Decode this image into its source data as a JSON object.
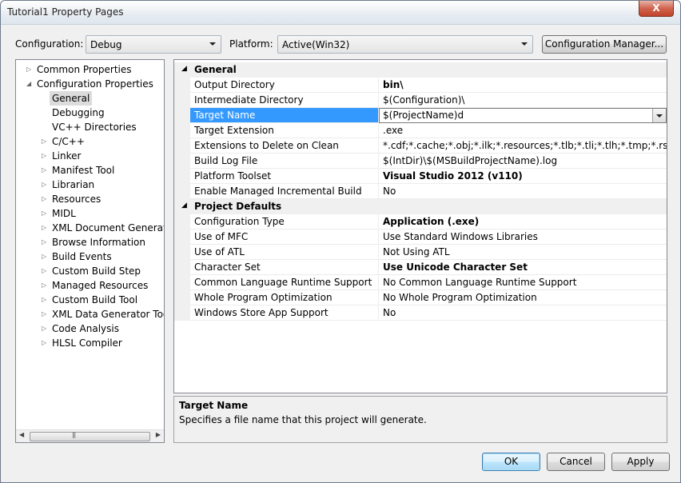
{
  "window": {
    "title": "Tutorial1 Property Pages",
    "close_glyph": "X"
  },
  "toolbar": {
    "configuration_label": "Configuration:",
    "configuration_value": "Debug",
    "platform_label": "Platform:",
    "platform_value": "Active(Win32)",
    "config_manager_label": "Configuration Manager..."
  },
  "tree": {
    "items": [
      {
        "label": "Common Properties",
        "expander": "right"
      },
      {
        "label": "Configuration Properties",
        "expander": "down"
      },
      {
        "label": "General",
        "selected": true
      },
      {
        "label": "Debugging"
      },
      {
        "label": "VC++ Directories"
      },
      {
        "label": "C/C++",
        "expander": "right"
      },
      {
        "label": "Linker",
        "expander": "right"
      },
      {
        "label": "Manifest Tool",
        "expander": "right"
      },
      {
        "label": "Librarian",
        "expander": "right"
      },
      {
        "label": "Resources",
        "expander": "right"
      },
      {
        "label": "MIDL",
        "expander": "right"
      },
      {
        "label": "XML Document Generator",
        "expander": "right"
      },
      {
        "label": "Browse Information",
        "expander": "right"
      },
      {
        "label": "Build Events",
        "expander": "right"
      },
      {
        "label": "Custom Build Step",
        "expander": "right"
      },
      {
        "label": "Managed Resources",
        "expander": "right"
      },
      {
        "label": "Custom Build Tool",
        "expander": "right"
      },
      {
        "label": "XML Data Generator Tool",
        "expander": "right"
      },
      {
        "label": "Code Analysis",
        "expander": "right"
      },
      {
        "label": "HLSL Compiler",
        "expander": "right"
      }
    ]
  },
  "grid": {
    "categories": [
      {
        "name": "General",
        "rows": [
          {
            "name": "Output Directory",
            "value": "bin\\",
            "bold": true
          },
          {
            "name": "Intermediate Directory",
            "value": "$(Configuration)\\"
          },
          {
            "name": "Target Name",
            "value": "$(ProjectName)d",
            "selected": true
          },
          {
            "name": "Target Extension",
            "value": ".exe"
          },
          {
            "name": "Extensions to Delete on Clean",
            "value": "*.cdf;*.cache;*.obj;*.ilk;*.resources;*.tlb;*.tli;*.tlh;*.tmp;*.rsp;*.pgc;*.pgd"
          },
          {
            "name": "Build Log File",
            "value": "$(IntDir)\\$(MSBuildProjectName).log"
          },
          {
            "name": "Platform Toolset",
            "value": "Visual Studio 2012 (v110)",
            "bold": true
          },
          {
            "name": "Enable Managed Incremental Build",
            "value": "No"
          }
        ]
      },
      {
        "name": "Project Defaults",
        "rows": [
          {
            "name": "Configuration Type",
            "value": "Application (.exe)",
            "bold": true
          },
          {
            "name": "Use of MFC",
            "value": "Use Standard Windows Libraries"
          },
          {
            "name": "Use of ATL",
            "value": "Not Using ATL"
          },
          {
            "name": "Character Set",
            "value": "Use Unicode Character Set",
            "bold": true
          },
          {
            "name": "Common Language Runtime Support",
            "value": "No Common Language Runtime Support"
          },
          {
            "name": "Whole Program Optimization",
            "value": "No Whole Program Optimization"
          },
          {
            "name": "Windows Store App Support",
            "value": "No"
          }
        ]
      }
    ]
  },
  "description": {
    "title": "Target Name",
    "text": "Specifies a file name that this project will generate."
  },
  "buttons": {
    "ok": "OK",
    "cancel": "Cancel",
    "apply": "Apply"
  }
}
